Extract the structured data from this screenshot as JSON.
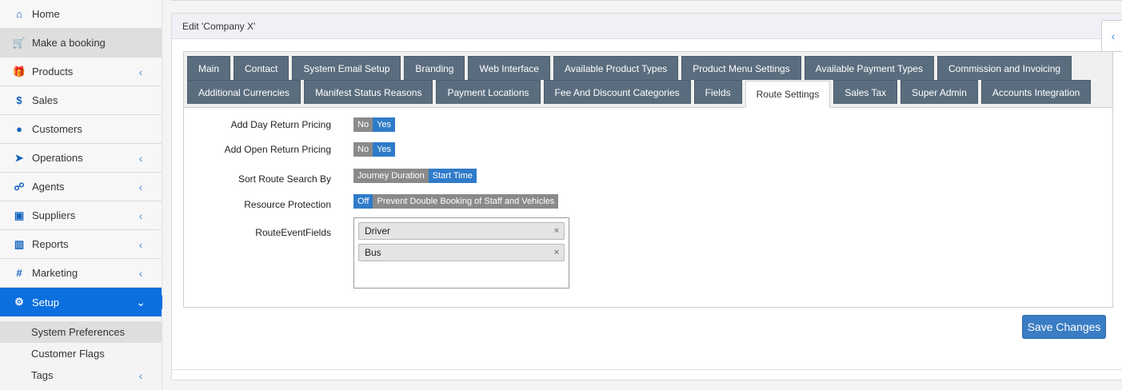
{
  "sidebar": {
    "items": [
      {
        "label": "Home",
        "icon": "home-icon",
        "glyph": "⌂",
        "chevron": false
      },
      {
        "label": "Make a booking",
        "icon": "cart-icon",
        "glyph": "🛒",
        "chevron": false
      },
      {
        "label": "Products",
        "icon": "gift-icon",
        "glyph": "🎁",
        "chevron": true
      },
      {
        "label": "Sales",
        "icon": "dollar-icon",
        "glyph": "$",
        "chevron": false
      },
      {
        "label": "Customers",
        "icon": "user-icon",
        "glyph": "●",
        "chevron": false
      },
      {
        "label": "Operations",
        "icon": "paper-plane-icon",
        "glyph": "➤",
        "chevron": true
      },
      {
        "label": "Agents",
        "icon": "sitemap-icon",
        "glyph": "☍",
        "chevron": true
      },
      {
        "label": "Suppliers",
        "icon": "address-book-icon",
        "glyph": "▣",
        "chevron": true
      },
      {
        "label": "Reports",
        "icon": "bar-chart-icon",
        "glyph": "▥",
        "chevron": true
      },
      {
        "label": "Marketing",
        "icon": "hashtag-icon",
        "glyph": "#",
        "chevron": true
      },
      {
        "label": "Setup",
        "icon": "gear-icon",
        "glyph": "⚙",
        "chevron": true
      }
    ],
    "subitems": [
      {
        "label": "System Preferences"
      },
      {
        "label": "Customer Flags"
      },
      {
        "label": "Tags"
      }
    ]
  },
  "panel": {
    "title": "Edit 'Company X'"
  },
  "tabs": {
    "row1": [
      "Main",
      "Contact",
      "System Email Setup",
      "Branding",
      "Web Interface",
      "Available Product Types",
      "Product Menu Settings",
      "Available Payment Types",
      "Commission and Invoicing"
    ],
    "row2": [
      "Additional Currencies",
      "Manifest Status Reasons",
      "Payment Locations",
      "Fee And Discount Categories",
      "Fields",
      "Route Settings",
      "Sales Tax",
      "Super Admin",
      "Accounts Integration"
    ],
    "active": "Route Settings"
  },
  "form": {
    "day_return": {
      "label": "Add Day Return Pricing",
      "off": "No",
      "on": "Yes"
    },
    "open_return": {
      "label": "Add Open Return Pricing",
      "off": "No",
      "on": "Yes"
    },
    "sort_route": {
      "label": "Sort Route Search By",
      "off": "Journey Duration",
      "on": "Start Time"
    },
    "resource": {
      "label": "Resource Protection",
      "on": "Off",
      "off": "Prevent Double Booking of Staff and Vehicles"
    },
    "route_fields": {
      "label": "RouteEventFields",
      "chips": [
        "Driver",
        "Bus"
      ]
    }
  },
  "actions": {
    "save_label": "Save Changes"
  },
  "colors": {
    "accent": "#0b6fde",
    "tab": "#5a6d7e",
    "toggle_on": "#2f7bc9"
  }
}
